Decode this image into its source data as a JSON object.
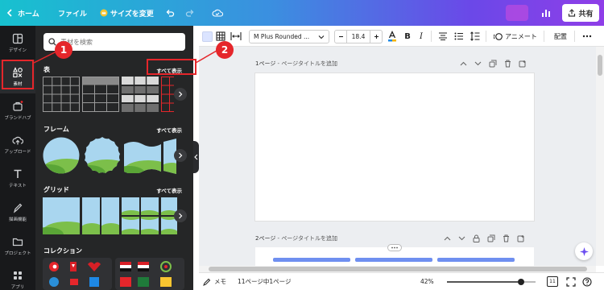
{
  "topbar": {
    "home_label": "ホーム",
    "file_label": "ファイル",
    "resize_label": "サイズを変更",
    "share_label": "共有"
  },
  "rail": {
    "items": [
      {
        "label": "デザイン",
        "icon": "layout-icon"
      },
      {
        "label": "素材",
        "icon": "elements-icon"
      },
      {
        "label": "ブランドハブ",
        "icon": "brand-icon"
      },
      {
        "label": "アップロード",
        "icon": "upload-icon"
      },
      {
        "label": "テキスト",
        "icon": "text-icon"
      },
      {
        "label": "描画機能",
        "icon": "draw-icon"
      },
      {
        "label": "プロジェクト",
        "icon": "folder-icon"
      },
      {
        "label": "アプリ",
        "icon": "apps-icon"
      }
    ]
  },
  "panel": {
    "search_placeholder": "素材を検索",
    "sections": {
      "tables": {
        "title": "表",
        "see_all": "すべて表示"
      },
      "frames": {
        "title": "フレーム",
        "see_all": "すべて表示"
      },
      "grids": {
        "title": "グリッド",
        "see_all": "すべて表示"
      },
      "collections": {
        "title": "コレクション"
      }
    }
  },
  "toolbar": {
    "font_name": "M Plus Rounded ...",
    "font_size": "18.4",
    "bold": "B",
    "italic": "I",
    "animate_label": "アニメート",
    "position_label": "配置"
  },
  "pages": [
    {
      "label": "1ページ",
      "title_placeholder": "ページタイトルを追加"
    },
    {
      "label": "2ページ",
      "title_placeholder": "ページタイトルを追加"
    }
  ],
  "bottom": {
    "notes_label": "メモ",
    "page_count": "11ページ中1ページ",
    "zoom": "42%",
    "zoom_level": 0.42,
    "page_badge": "11"
  },
  "annotations": {
    "badge_1": "1",
    "badge_2": "2"
  },
  "colors": {
    "accent_red": "#e5262b",
    "topbar_start": "#17c1cf",
    "topbar_end": "#8f3ee8",
    "rail_bg": "#18191b",
    "panel_bg": "#252627"
  }
}
